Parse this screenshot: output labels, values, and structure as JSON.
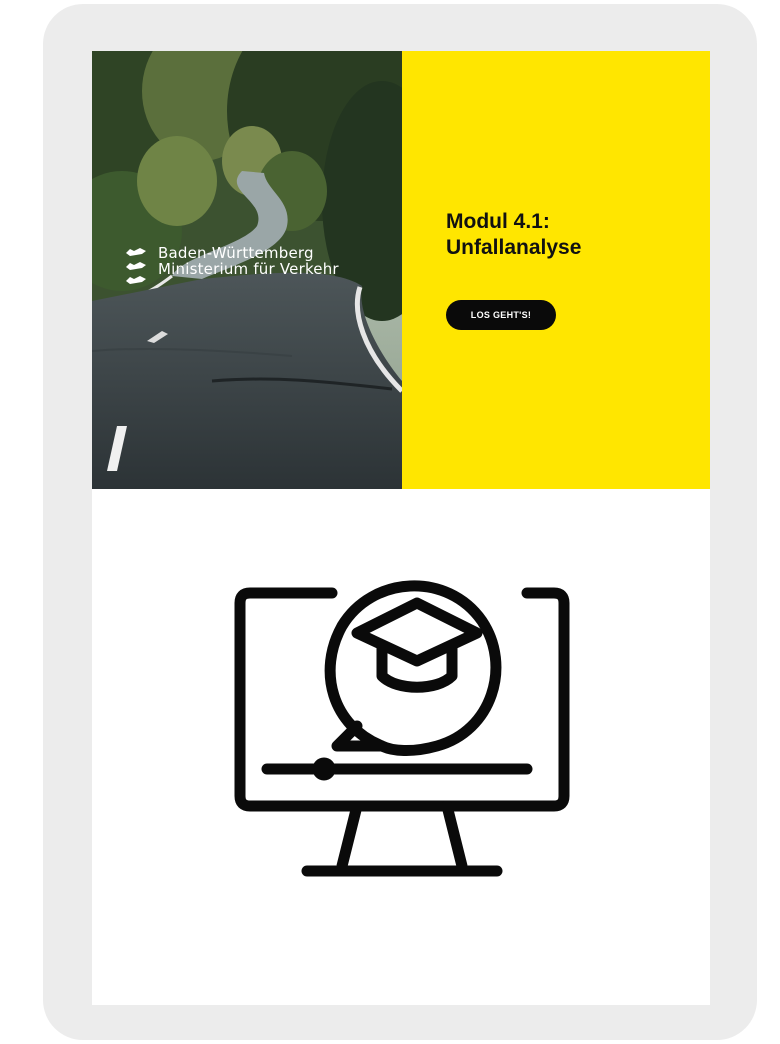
{
  "brand": {
    "line1": "Baden-Württemberg",
    "line2": "Ministerium für Verkehr",
    "logo_icon": "lion-coat-of-arms-icon"
  },
  "module": {
    "title_line1": "Modul 4.1:",
    "title_line2": "Unfallanalyse",
    "cta_label": "LOS GEHT'S!"
  },
  "illustration": {
    "icon": "online-learning-monitor-icon"
  },
  "colors": {
    "accent_yellow": "#ffe600",
    "button_black": "#0a0a0a",
    "frame_gray": "#ececec"
  }
}
